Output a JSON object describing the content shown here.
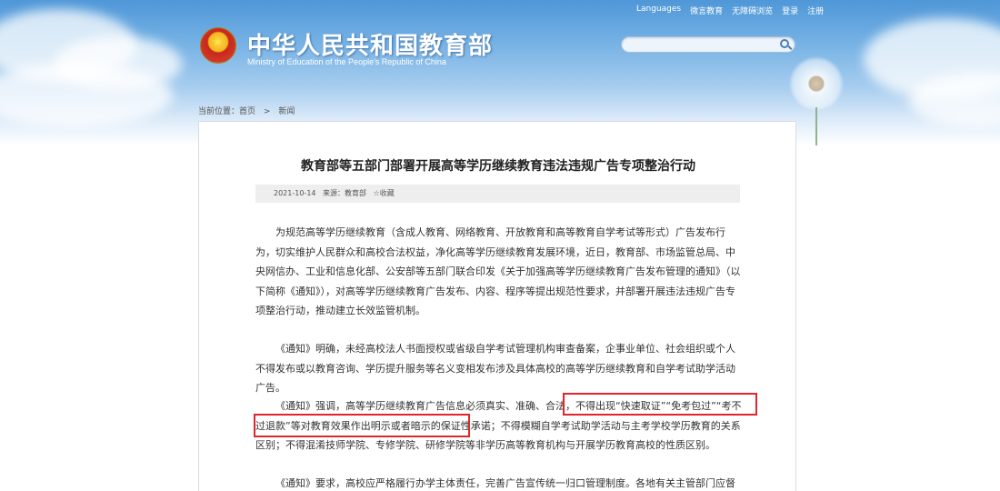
{
  "top_links": [
    "Languages",
    "微言教育",
    "无障碍浏览",
    "登录",
    "注册"
  ],
  "header": {
    "title": "中华人民共和国教育部",
    "subtitle": "Ministry of Education of the People's Republic of China",
    "search_placeholder": ""
  },
  "breadcrumb": {
    "label": "当前位置：",
    "home": "首页",
    "separator": ">",
    "current": "新闻"
  },
  "article": {
    "title": "教育部等五部门部署开展高等学历继续教育违法违规广告专项整治行动",
    "date": "2021-10-14",
    "source": "来源：教育部",
    "favorite": "☆收藏",
    "paragraphs": [
      "为规范高等学历继续教育（含成人教育、网络教育、开放教育和高等教育自学考试等形式）广告发布行为，切实维护人民群众和高校合法权益，净化高等学历继续教育发展环境，近日，教育部、市场监管总局、中央网信办、工业和信息化部、公安部等五部门联合印发《关于加强高等学历继续教育广告发布管理的通知》（以下简称《通知》），对高等学历继续教育广告发布、内容、程序等提出规范性要求，并部署开展违法违规广告专项整治行动，推动建立长效监管机制。",
      "《通知》明确，未经高校法人书面授权或省级自学考试管理机构审查备案，企事业单位、社会组织或个人不得发布或以教育咨询、学历提升服务等名义变相发布涉及具体高校的高等学历继续教育和自学考试助学活动广告。",
      "《通知》强调，高等学历继续教育广告信息必须真实、准确、合法，不得出现“快速取证”“免考包过”“考不过退款”等对教育效果作出明示或者暗示的保证性承诺；不得模糊自学考试助学活动与主考学校学历教育的关系区别；不得混淆技师学院、专修学院、研修学院等非学历高等教育机构与开展学历教育高校的性质区别。",
      "《通知》要求，高校应严格履行办学主体责任，完善广告宣传统一归口管理制度。各地有关主管部门应督促各"
    ]
  },
  "colors": {
    "highlight": "#e0252b",
    "header_blue": "#4f97d8"
  }
}
